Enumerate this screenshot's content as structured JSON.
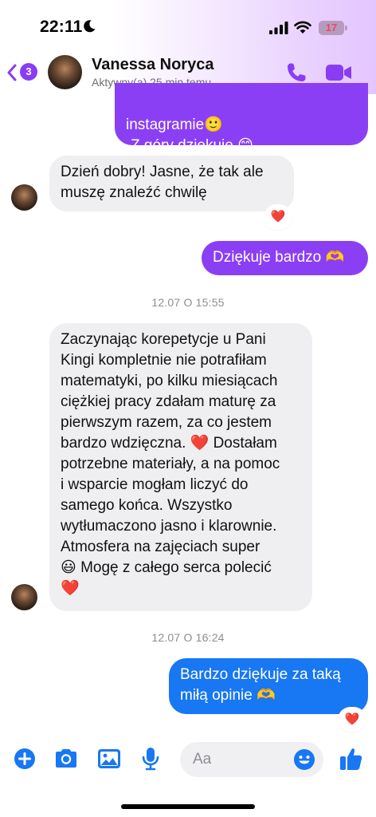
{
  "status_bar": {
    "time": "22:11",
    "battery": "17"
  },
  "header": {
    "back_badge": "3",
    "contact_name": "Vanessa Noryca",
    "contact_status": "Aktywny(a) 25 min temu"
  },
  "messages": [
    {
      "direction": "outgoing",
      "line1": "instagramie🙂",
      "line2": "Z góry dziękuje 😊"
    },
    {
      "direction": "incoming",
      "text": "Dzień dobry! Jasne, że tak ale\nmuszę znaleźć chwilę",
      "reaction": "❤️"
    },
    {
      "direction": "outgoing",
      "text": "Dziękuje bardzo 🫶"
    },
    {
      "direction": "incoming",
      "text": "Zaczynając korepetycje u Pani\nKingi kompletnie nie potrafiłam\nmatematyki, po kilku miesiącach\nciężkiej pracy zdałam maturę za\npierwszym razem, za co jestem\nbardzo wdzięczna. ❤️ Dostałam\npotrzebne materiały, a na pomoc\ni wsparcie mogłam liczyć do\nsamego końca. Wszystko\nwytłumaczono jasno i klarownie.\nAtmosfera na zajęciach super\n😃 Mogę z całego serca polecić\n❤️"
    },
    {
      "direction": "outgoing",
      "text": "Bardzo dziękuje za taką\nmiłą opinie 🫶",
      "reaction": "❤️"
    }
  ],
  "timestamps": [
    "12.07 O 15:55",
    "12.07 O 16:24"
  ],
  "composer": {
    "placeholder": "Aa"
  },
  "icons": {
    "status": [
      "moon-icon",
      "signal-icon",
      "wifi-icon",
      "battery-icon"
    ],
    "header": [
      "back-chevron-icon",
      "phone-icon",
      "video-camera-icon"
    ],
    "composer": [
      "plus-icon",
      "camera-icon",
      "image-icon",
      "microphone-icon",
      "smile-icon",
      "thumbs-up-icon"
    ]
  },
  "colors": {
    "accent_purple": "#8b3ff5",
    "outgoing_blue": "#1877f2",
    "incoming_bg": "#efeff1"
  }
}
